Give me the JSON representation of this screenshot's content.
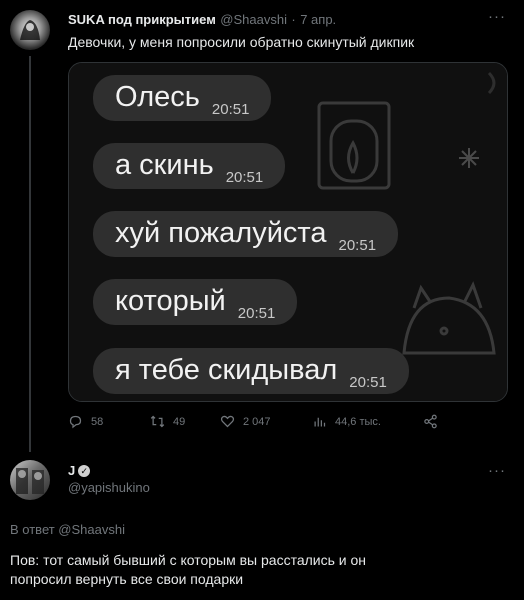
{
  "tweet": {
    "author_name": "SUKA под прикрытием",
    "author_handle": "@Shaavshi",
    "time_sep": "·",
    "date": "7 апр.",
    "text": "Девочки, у меня попросили обратно скинутый дикпик",
    "more": "···",
    "screenshot_messages": [
      {
        "text": "Олесь",
        "time": "20:51"
      },
      {
        "text": "а скинь",
        "time": "20:51"
      },
      {
        "text": "хуй пожалуйста",
        "time": "20:51"
      },
      {
        "text": "который",
        "time": "20:51"
      },
      {
        "text": "я тебе скидывал",
        "time": "20:51"
      }
    ],
    "stats": {
      "replies": "58",
      "retweets": "49",
      "likes": "2 047",
      "views": "44,6 тыс."
    },
    "icons": [
      "reply-icon",
      "retweet-icon",
      "like-icon",
      "views-icon",
      "share-icon"
    ]
  },
  "reply": {
    "author_name": "J",
    "author_handle": "@yapishukino",
    "more": "···",
    "in_reply_to": "В ответ @Shaavshi",
    "text_line1": "Пов: тот самый бывший с которым вы расстались и он",
    "text_line2": "попросил вернуть все свои подарки"
  }
}
